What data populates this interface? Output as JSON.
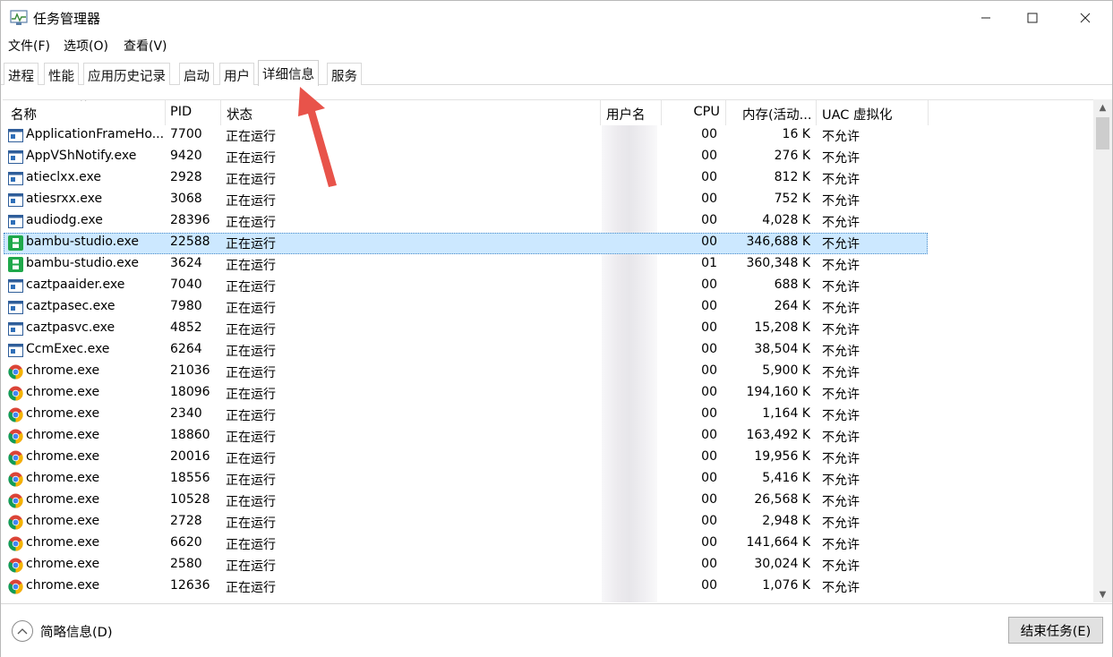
{
  "window": {
    "title": "任务管理器"
  },
  "menu": [
    "文件(F)",
    "选项(O)",
    "查看(V)"
  ],
  "tabs": [
    "进程",
    "性能",
    "应用历史记录",
    "启动",
    "用户",
    "详细信息",
    "服务"
  ],
  "active_tab": "详细信息",
  "columns": {
    "name": "名称",
    "pid": "PID",
    "status": "状态",
    "user": "用户名",
    "cpu": "CPU",
    "memory": "内存(活动...",
    "uac": "UAC 虚拟化"
  },
  "rows": [
    {
      "icon": "app-window-icon",
      "name": "ApplicationFrameHo...",
      "pid": "7700",
      "status": "正在运行",
      "cpu": "00",
      "memory": "16 K",
      "uac": "不允许"
    },
    {
      "icon": "app-window-icon",
      "name": "AppVShNotify.exe",
      "pid": "9420",
      "status": "正在运行",
      "cpu": "00",
      "memory": "276 K",
      "uac": "不允许"
    },
    {
      "icon": "app-window-icon",
      "name": "atieclxx.exe",
      "pid": "2928",
      "status": "正在运行",
      "cpu": "00",
      "memory": "812 K",
      "uac": "不允许"
    },
    {
      "icon": "app-window-icon",
      "name": "atiesrxx.exe",
      "pid": "3068",
      "status": "正在运行",
      "cpu": "00",
      "memory": "752 K",
      "uac": "不允许"
    },
    {
      "icon": "app-window-icon",
      "name": "audiodg.exe",
      "pid": "28396",
      "status": "正在运行",
      "cpu": "00",
      "memory": "4,028 K",
      "uac": "不允许"
    },
    {
      "icon": "bambu-icon",
      "name": "bambu-studio.exe",
      "pid": "22588",
      "status": "正在运行",
      "cpu": "00",
      "memory": "346,688 K",
      "uac": "不允许",
      "selected": true
    },
    {
      "icon": "bambu-icon",
      "name": "bambu-studio.exe",
      "pid": "3624",
      "status": "正在运行",
      "cpu": "01",
      "memory": "360,348 K",
      "uac": "不允许"
    },
    {
      "icon": "app-window-icon",
      "name": "caztpaaider.exe",
      "pid": "7040",
      "status": "正在运行",
      "cpu": "00",
      "memory": "688 K",
      "uac": "不允许"
    },
    {
      "icon": "app-window-icon",
      "name": "caztpasec.exe",
      "pid": "7980",
      "status": "正在运行",
      "cpu": "00",
      "memory": "264 K",
      "uac": "不允许"
    },
    {
      "icon": "app-window-icon",
      "name": "caztpasvc.exe",
      "pid": "4852",
      "status": "正在运行",
      "cpu": "00",
      "memory": "15,208 K",
      "uac": "不允许"
    },
    {
      "icon": "app-window-icon",
      "name": "CcmExec.exe",
      "pid": "6264",
      "status": "正在运行",
      "cpu": "00",
      "memory": "38,504 K",
      "uac": "不允许"
    },
    {
      "icon": "chrome-icon",
      "name": "chrome.exe",
      "pid": "21036",
      "status": "正在运行",
      "cpu": "00",
      "memory": "5,900 K",
      "uac": "不允许"
    },
    {
      "icon": "chrome-icon",
      "name": "chrome.exe",
      "pid": "18096",
      "status": "正在运行",
      "cpu": "00",
      "memory": "194,160 K",
      "uac": "不允许"
    },
    {
      "icon": "chrome-icon",
      "name": "chrome.exe",
      "pid": "2340",
      "status": "正在运行",
      "cpu": "00",
      "memory": "1,164 K",
      "uac": "不允许"
    },
    {
      "icon": "chrome-icon",
      "name": "chrome.exe",
      "pid": "18860",
      "status": "正在运行",
      "cpu": "00",
      "memory": "163,492 K",
      "uac": "不允许"
    },
    {
      "icon": "chrome-icon",
      "name": "chrome.exe",
      "pid": "20016",
      "status": "正在运行",
      "cpu": "00",
      "memory": "19,956 K",
      "uac": "不允许"
    },
    {
      "icon": "chrome-icon",
      "name": "chrome.exe",
      "pid": "18556",
      "status": "正在运行",
      "cpu": "00",
      "memory": "5,416 K",
      "uac": "不允许"
    },
    {
      "icon": "chrome-icon",
      "name": "chrome.exe",
      "pid": "10528",
      "status": "正在运行",
      "cpu": "00",
      "memory": "26,568 K",
      "uac": "不允许"
    },
    {
      "icon": "chrome-icon",
      "name": "chrome.exe",
      "pid": "2728",
      "status": "正在运行",
      "cpu": "00",
      "memory": "2,948 K",
      "uac": "不允许"
    },
    {
      "icon": "chrome-icon",
      "name": "chrome.exe",
      "pid": "6620",
      "status": "正在运行",
      "cpu": "00",
      "memory": "141,664 K",
      "uac": "不允许"
    },
    {
      "icon": "chrome-icon",
      "name": "chrome.exe",
      "pid": "2580",
      "status": "正在运行",
      "cpu": "00",
      "memory": "30,024 K",
      "uac": "不允许"
    },
    {
      "icon": "chrome-icon",
      "name": "chrome.exe",
      "pid": "12636",
      "status": "正在运行",
      "cpu": "00",
      "memory": "1,076 K",
      "uac": "不允许"
    }
  ],
  "footer": {
    "fewer_details": "简略信息(D)",
    "end_task": "结束任务(E)"
  },
  "colors": {
    "selection": "#cce8ff",
    "annotation_arrow": "#e8534a"
  }
}
